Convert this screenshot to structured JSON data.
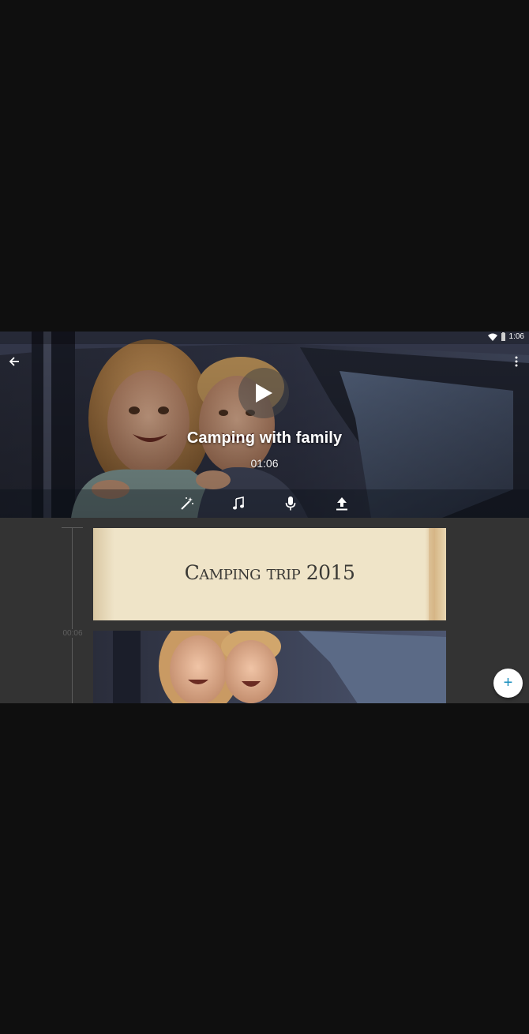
{
  "status_bar": {
    "time": "1:06"
  },
  "project": {
    "title": "Camping with family",
    "duration": "01:06"
  },
  "toolbar": {
    "items": [
      "magic-wand-icon",
      "music-note-icon",
      "microphone-icon",
      "upload-icon"
    ]
  },
  "timeline": {
    "marker_time": "00:06",
    "clips": [
      {
        "type": "title",
        "text": "Camping trip 2015"
      },
      {
        "type": "video"
      }
    ]
  },
  "fab": {
    "symbol": "+"
  },
  "colors": {
    "background": "#0f0f0f",
    "timeline_bg": "#333333",
    "fab_accent": "#1a8fbe",
    "title_card_paper": "#efe4c8"
  }
}
